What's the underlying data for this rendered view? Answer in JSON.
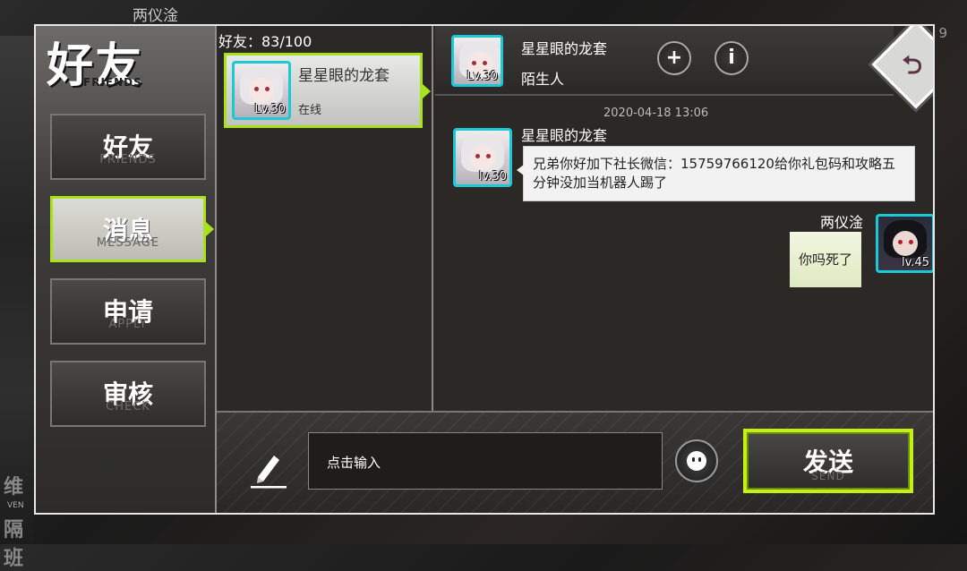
{
  "background": {
    "player_name": "两仪淦",
    "right_number": "9",
    "left_glyphs": [
      "维",
      "隔班"
    ],
    "left_mini": "VEN"
  },
  "nav": {
    "title": "好友",
    "title_en": "FRIENDS",
    "items": [
      {
        "label": "好友",
        "sub": "FRIENDS",
        "active": false
      },
      {
        "label": "消息",
        "sub": "MESSAGE",
        "active": true
      },
      {
        "label": "申请",
        "sub": "APPLY",
        "active": false
      },
      {
        "label": "审核",
        "sub": "CHECK",
        "active": false
      }
    ]
  },
  "friend_list": {
    "count_label": "好友：83/100",
    "items": [
      {
        "name": "星星眼的龙套",
        "status": "在线",
        "level": "Lv.30"
      }
    ]
  },
  "chat": {
    "header": {
      "name": "星星眼的龙套",
      "relation": "陌生人",
      "level": "Lv.30",
      "add_icon": "+",
      "info_icon": "i"
    },
    "back_icon": "⮌",
    "timestamp": "2020-04-18 13:06",
    "messages": [
      {
        "sender": "星星眼的龙套",
        "level": "lv.30",
        "text": "兄弟你好加下社长微信：15759766120给你礼包码和攻略五分钟没加当机器人踢了",
        "side": "left"
      },
      {
        "sender": "两仪淦",
        "level": "lv.45",
        "text": "你吗死了",
        "side": "right"
      }
    ]
  },
  "input": {
    "placeholder": "点击输入",
    "send_label": "发送",
    "send_sub": "SEND"
  },
  "colors": {
    "accent": "#a8e21c",
    "avatar_border": "#19c9d6"
  },
  "icons": {
    "edit": "pencil-icon",
    "emoji": "emoji-icon",
    "add": "plus-icon",
    "info": "info-icon",
    "back": "back-arrow-icon"
  }
}
